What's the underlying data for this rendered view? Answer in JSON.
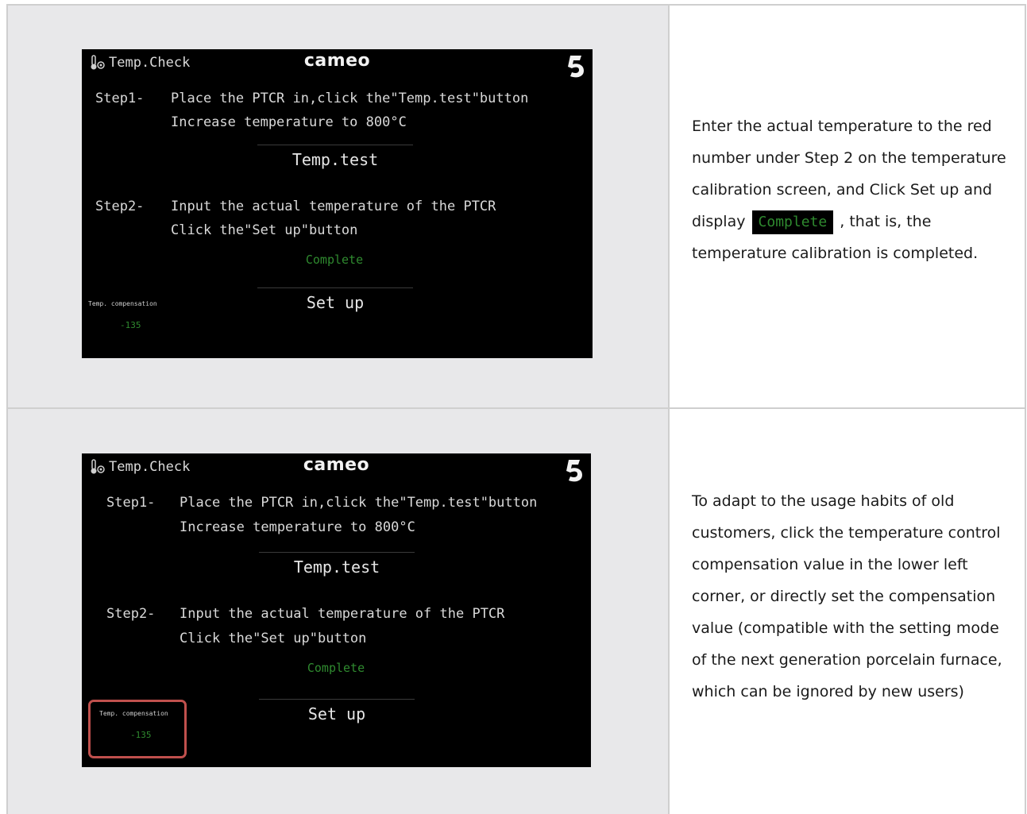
{
  "rows": [
    {
      "screen": {
        "title": "Temp.Check",
        "brand": "cameo",
        "step1_label": "Step1-",
        "step1_line1": "Place the PTCR in,click the\"Temp.test\"button",
        "step1_line2": "Increase temperature to 800°C",
        "temp_test_button": "Temp.test",
        "step2_label": "Step2-",
        "step2_line1": "Input the actual temperature of the PTCR",
        "step2_line2": "Click the\"Set up\"button",
        "status": "Complete",
        "setup_button": "Set up",
        "compensation_label": "Temp. compensation",
        "compensation_value": "-135"
      },
      "description": {
        "part1": "Enter the actual temperature to the red number under Step 2 on the temperature calibration screen, and Click Set up   and display ",
        "badge": "Complete",
        "part2": "  , that is, the temperature calibration is completed."
      }
    },
    {
      "screen": {
        "title": "Temp.Check",
        "brand": "cameo",
        "step1_label": "Step1-",
        "step1_line1": "Place the PTCR in,click the\"Temp.test\"button",
        "step1_line2": "Increase temperature to 800°C",
        "temp_test_button": "Temp.test",
        "step2_label": "Step2-",
        "step2_line1": "Input the actual temperature of the PTCR",
        "step2_line2": "Click the\"Set up\"button",
        "status": "Complete",
        "setup_button": "Set up",
        "compensation_label": "Temp. compensation",
        "compensation_value": "-135"
      },
      "description": {
        "text": "To adapt to the usage habits of old customers, click the temperature control compensation value in the lower left corner, or directly set the compensation value (compatible with the setting mode of the next generation porcelain furnace, which can be ignored by new users)"
      }
    }
  ],
  "colors": {
    "screen_bg": "#000000",
    "status_green": "#2f8a2f",
    "highlight_red": "#c0504d",
    "cell_gray": "#e8e8ea"
  },
  "icons": [
    "thermometer-gear-icon",
    "back-arrow-icon"
  ]
}
